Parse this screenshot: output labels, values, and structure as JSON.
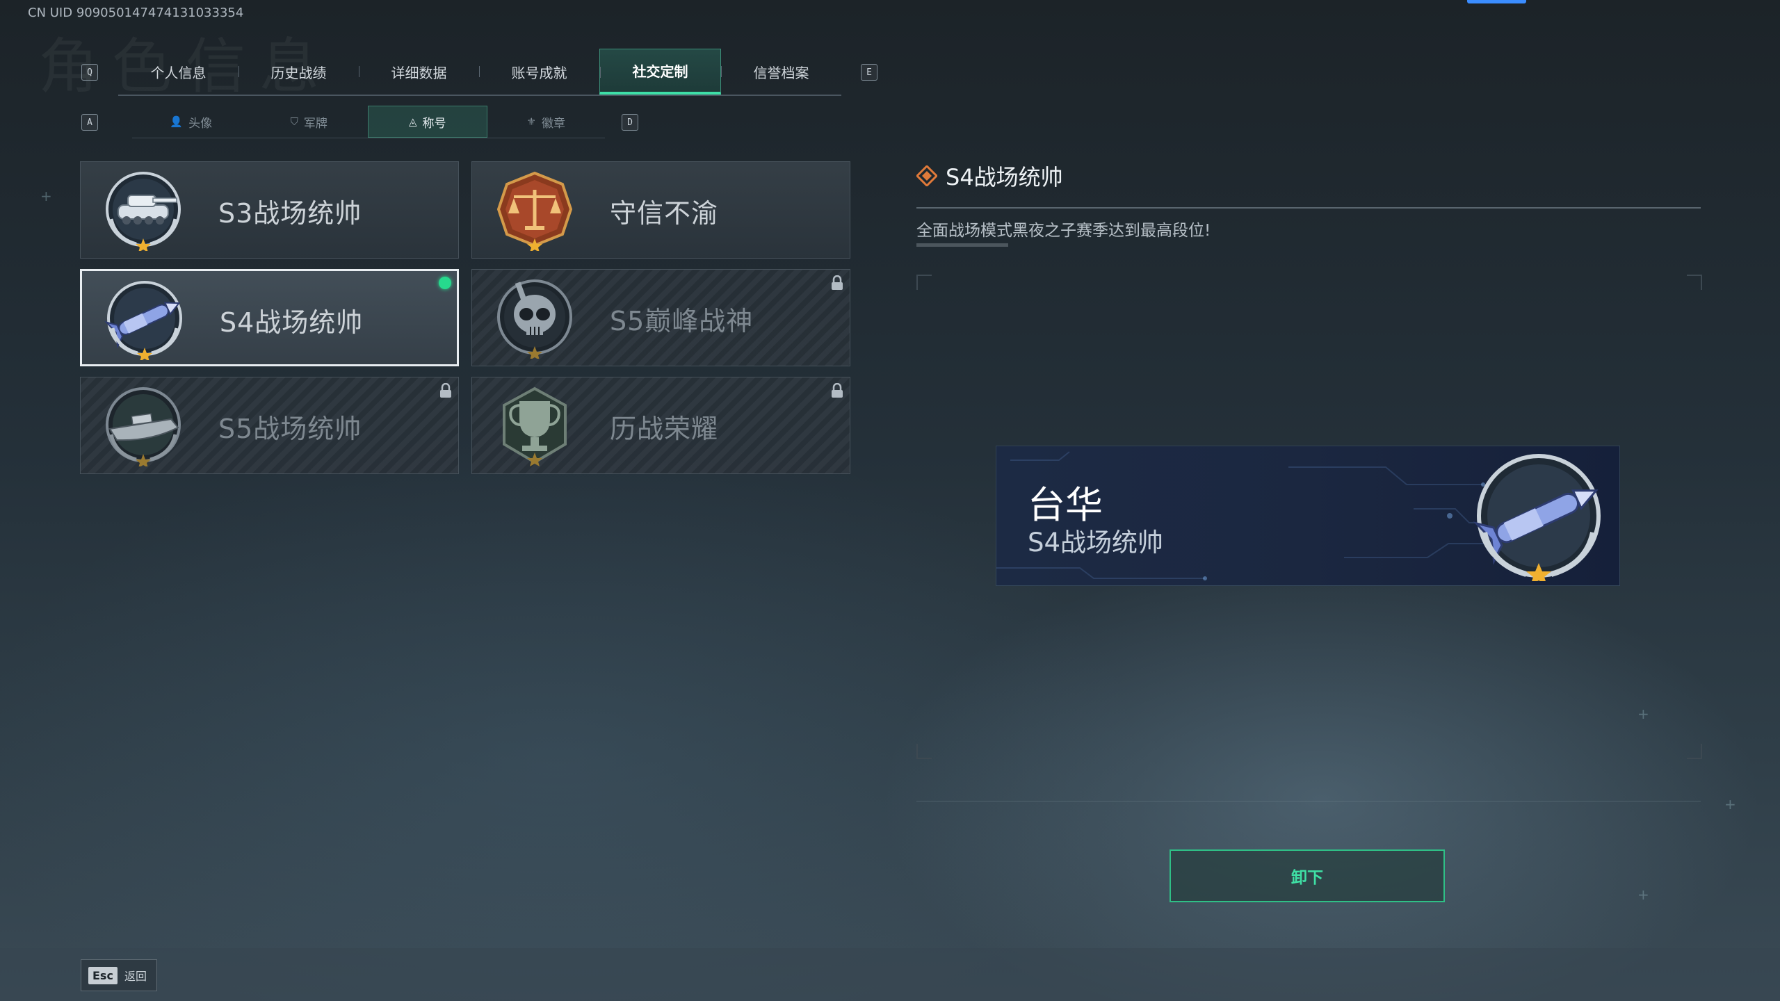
{
  "header": {
    "uid": "CN UID 909050147474131033354",
    "watermark": "角色信息",
    "key_left": "Q",
    "key_right": "E"
  },
  "tabs": [
    {
      "label": "个人信息",
      "active": false
    },
    {
      "label": "历史战绩",
      "active": false
    },
    {
      "label": "详细数据",
      "active": false
    },
    {
      "label": "账号成就",
      "active": false
    },
    {
      "label": "社交定制",
      "active": true
    },
    {
      "label": "信誉档案",
      "active": false
    }
  ],
  "subtabs": {
    "key_left": "A",
    "key_right": "D",
    "items": [
      {
        "label": "头像",
        "icon": "person-icon",
        "glyph": "👤",
        "active": false
      },
      {
        "label": "军牌",
        "icon": "dogtag-icon",
        "glyph": "⛉",
        "active": false
      },
      {
        "label": "称号",
        "icon": "title-triangle-icon",
        "glyph": "◬",
        "active": true
      },
      {
        "label": "徽章",
        "icon": "badge-icon",
        "glyph": "⚜",
        "active": false
      }
    ]
  },
  "titles": [
    {
      "label": "S3战场统帅",
      "emblem": "tank-emblem",
      "locked": false,
      "selected": false,
      "equipped": false
    },
    {
      "label": "守信不渝",
      "emblem": "scales-emblem",
      "locked": false,
      "selected": false,
      "equipped": false
    },
    {
      "label": "S4战场统帅",
      "emblem": "missile-emblem",
      "locked": false,
      "selected": true,
      "equipped": true
    },
    {
      "label": "S5巅峰战神",
      "emblem": "skull-emblem",
      "locked": true,
      "selected": false,
      "equipped": false
    },
    {
      "label": "S5战场统帅",
      "emblem": "boat-emblem",
      "locked": true,
      "selected": false,
      "equipped": false
    },
    {
      "label": "历战荣耀",
      "emblem": "trophy-emblem",
      "locked": true,
      "selected": false,
      "equipped": false
    }
  ],
  "detail": {
    "title": "S4战场统帅",
    "description": "全面战场模式黑夜之子赛季达到最高段位!"
  },
  "nameplate": {
    "player_name": "台华",
    "title": "S4战场统帅"
  },
  "actions": {
    "unequip_label": "卸下",
    "esc_key": "Esc",
    "back_label": "返回"
  },
  "colors": {
    "accent_green": "#3ee0a8",
    "equipped_dot": "#26d98d",
    "nameplate_bg": "#1b2740",
    "star_gold": "#f0b030"
  }
}
